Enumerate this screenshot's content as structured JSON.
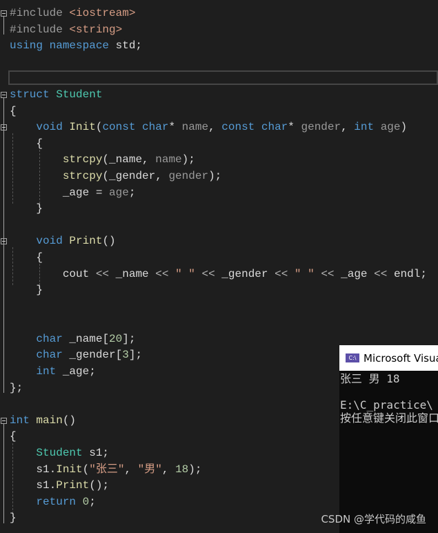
{
  "editor": {
    "lines": [
      [
        [
          "#include ",
          "pp"
        ],
        [
          "<iostream>",
          "st"
        ]
      ],
      [
        [
          "#include ",
          "pp"
        ],
        [
          "<string>",
          "st"
        ]
      ],
      [
        [
          "using namespace ",
          "kw"
        ],
        [
          "std;",
          ""
        ]
      ],
      [],
      [],
      [
        [
          "struct ",
          "kw"
        ],
        [
          "Student",
          "ty"
        ]
      ],
      [
        [
          "{",
          ""
        ]
      ],
      [
        [
          "    ",
          ""
        ],
        [
          "void ",
          "kw"
        ],
        [
          "Init",
          "fn"
        ],
        [
          "(",
          ""
        ],
        [
          "const char",
          "kw"
        ],
        [
          "* ",
          ""
        ],
        [
          "name",
          "pa"
        ],
        [
          ", ",
          ""
        ],
        [
          "const char",
          "kw"
        ],
        [
          "* ",
          ""
        ],
        [
          "gender",
          "pa"
        ],
        [
          ", ",
          ""
        ],
        [
          "int ",
          "kw"
        ],
        [
          "age",
          "pa"
        ],
        [
          ")",
          ""
        ]
      ],
      [
        [
          "    {",
          ""
        ]
      ],
      [
        [
          "        strcpy",
          "fn"
        ],
        [
          "(",
          ""
        ],
        [
          "_name",
          "mb"
        ],
        [
          ", ",
          ""
        ],
        [
          "name",
          "pa"
        ],
        [
          ");",
          ""
        ]
      ],
      [
        [
          "        strcpy",
          "fn"
        ],
        [
          "(",
          ""
        ],
        [
          "_gender",
          "mb"
        ],
        [
          ", ",
          ""
        ],
        [
          "gender",
          "pa"
        ],
        [
          ");",
          ""
        ]
      ],
      [
        [
          "        _age",
          "mb"
        ],
        [
          " = ",
          ""
        ],
        [
          "age",
          "pa"
        ],
        [
          ";",
          ""
        ]
      ],
      [
        [
          "    }",
          ""
        ]
      ],
      [],
      [
        [
          "    ",
          ""
        ],
        [
          "void ",
          "kw"
        ],
        [
          "Print",
          "fn"
        ],
        [
          "()",
          ""
        ]
      ],
      [
        [
          "    {",
          ""
        ]
      ],
      [
        [
          "        cout ",
          ""
        ],
        [
          "<< ",
          "op"
        ],
        [
          "_name ",
          "mb"
        ],
        [
          "<< ",
          "op"
        ],
        [
          "\" \" ",
          "st"
        ],
        [
          "<< ",
          "op"
        ],
        [
          "_gender ",
          "mb"
        ],
        [
          "<< ",
          "op"
        ],
        [
          "\" \" ",
          "st"
        ],
        [
          "<< ",
          "op"
        ],
        [
          "_age ",
          "mb"
        ],
        [
          "<< ",
          "op"
        ],
        [
          "endl;",
          ""
        ]
      ],
      [
        [
          "    }",
          ""
        ]
      ],
      [],
      [],
      [
        [
          "    ",
          ""
        ],
        [
          "char ",
          "kw"
        ],
        [
          "_name",
          "mb"
        ],
        [
          "[",
          ""
        ],
        [
          "20",
          "nu"
        ],
        [
          "];",
          ""
        ]
      ],
      [
        [
          "    ",
          ""
        ],
        [
          "char ",
          "kw"
        ],
        [
          "_gender",
          "mb"
        ],
        [
          "[",
          ""
        ],
        [
          "3",
          "nu"
        ],
        [
          "];",
          ""
        ]
      ],
      [
        [
          "    ",
          ""
        ],
        [
          "int ",
          "kw"
        ],
        [
          "_age",
          "mb"
        ],
        [
          ";",
          ""
        ]
      ],
      [
        [
          "};",
          ""
        ]
      ],
      [],
      [
        [
          "int ",
          "kw"
        ],
        [
          "main",
          "fn"
        ],
        [
          "()",
          ""
        ]
      ],
      [
        [
          "{",
          ""
        ]
      ],
      [
        [
          "    ",
          ""
        ],
        [
          "Student ",
          "ty"
        ],
        [
          "s1;",
          ""
        ]
      ],
      [
        [
          "    s1.",
          ""
        ],
        [
          "Init",
          "fn"
        ],
        [
          "(",
          ""
        ],
        [
          "\"张三\"",
          "st"
        ],
        [
          ", ",
          ""
        ],
        [
          "\"男\"",
          "st"
        ],
        [
          ", ",
          ""
        ],
        [
          "18",
          "nu"
        ],
        [
          ");",
          ""
        ]
      ],
      [
        [
          "    s1.",
          ""
        ],
        [
          "Print",
          "fn"
        ],
        [
          "();",
          ""
        ]
      ],
      [
        [
          "    ",
          ""
        ],
        [
          "return ",
          "kw"
        ],
        [
          "0",
          "nu"
        ],
        [
          ";",
          ""
        ]
      ],
      [
        [
          "}",
          ""
        ]
      ]
    ]
  },
  "console": {
    "title": "Microsoft Visual Studio 调试控制台",
    "icon": "console-app-icon",
    "output": [
      "张三 男 18",
      "",
      "E:\\C_practice\\",
      "按任意键关闭此窗口"
    ]
  },
  "watermark": "CSDN @学代码的咸鱼"
}
